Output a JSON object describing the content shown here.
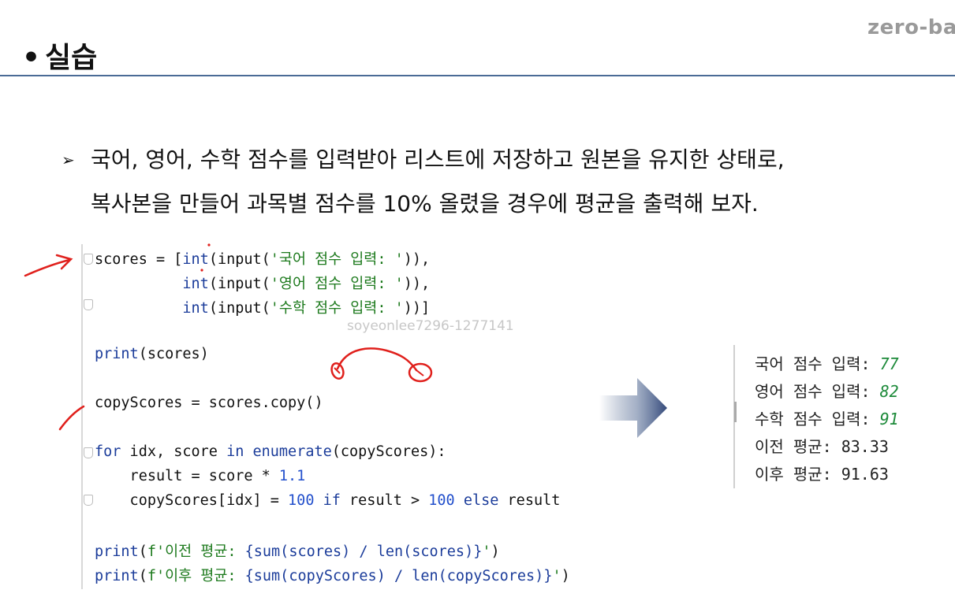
{
  "logo": "zero-ba",
  "title": {
    "bullet": "•",
    "text": "실습"
  },
  "description": {
    "bullet": "➢",
    "line1": "국어, 영어, 수학 점수를 입력받아 리스트에 저장하고 원본을 유지한 상태로,",
    "line2": "복사본을 만들어 과목별 점수를 10% 올렸을 경우에 평균을 출력해 보자."
  },
  "code": {
    "l1": {
      "a": "scores = [",
      "b": "int",
      "c": "(input(",
      "d": "'국어 점수 입력: '",
      "e": ")),"
    },
    "l2": {
      "a": "          ",
      "b": "int",
      "c": "(input(",
      "d": "'영어 점수 입력: '",
      "e": ")),"
    },
    "l3": {
      "a": "          ",
      "b": "int",
      "c": "(input(",
      "d": "'수학 점수 입력: '",
      "e": "))]"
    },
    "l4": {
      "a": "print",
      "b": "(scores)"
    },
    "l5": "copyScores = scores.copy()",
    "l6": {
      "a": "for",
      "b": " idx, score ",
      "c": "in",
      "d": " ",
      "e": "enumerate",
      "f": "(copyScores):"
    },
    "l7": {
      "a": "    result = score * ",
      "b": "1.1"
    },
    "l8": {
      "a": "    copyScores[idx] = ",
      "b": "100",
      "c": " ",
      "d": "if",
      "e": " result > ",
      "f": "100",
      "g": " ",
      "h": "else",
      "i": " result"
    },
    "l9": {
      "a": "print",
      "b": "(",
      "c": "f'이전 평균: ",
      "d": "{sum(scores) / len(scores)}",
      "e": "'",
      "f": ")"
    },
    "l10": {
      "a": "print",
      "b": "(",
      "c": "f'이후 평균: ",
      "d": "{sum(copyScores) / len(copyScores)}",
      "e": "'",
      "f": ")"
    }
  },
  "watermark": "soyeonlee7296-1277141",
  "console": {
    "r1_label": "국어 점수 입력: ",
    "r1_val": "77",
    "r2_label": "영어 점수 입력: ",
    "r2_val": "82",
    "r3_label": "수학 점수 입력: ",
    "r3_val": "91",
    "r4": "이전 평균: 83.33",
    "r5": "이후 평균: 91.63"
  },
  "colors": {
    "rule": "#4a6b96",
    "keyword": "#1b3c9a",
    "string": "#1d7a1d",
    "number": "#2350cc",
    "annotation": "#e0201c"
  }
}
